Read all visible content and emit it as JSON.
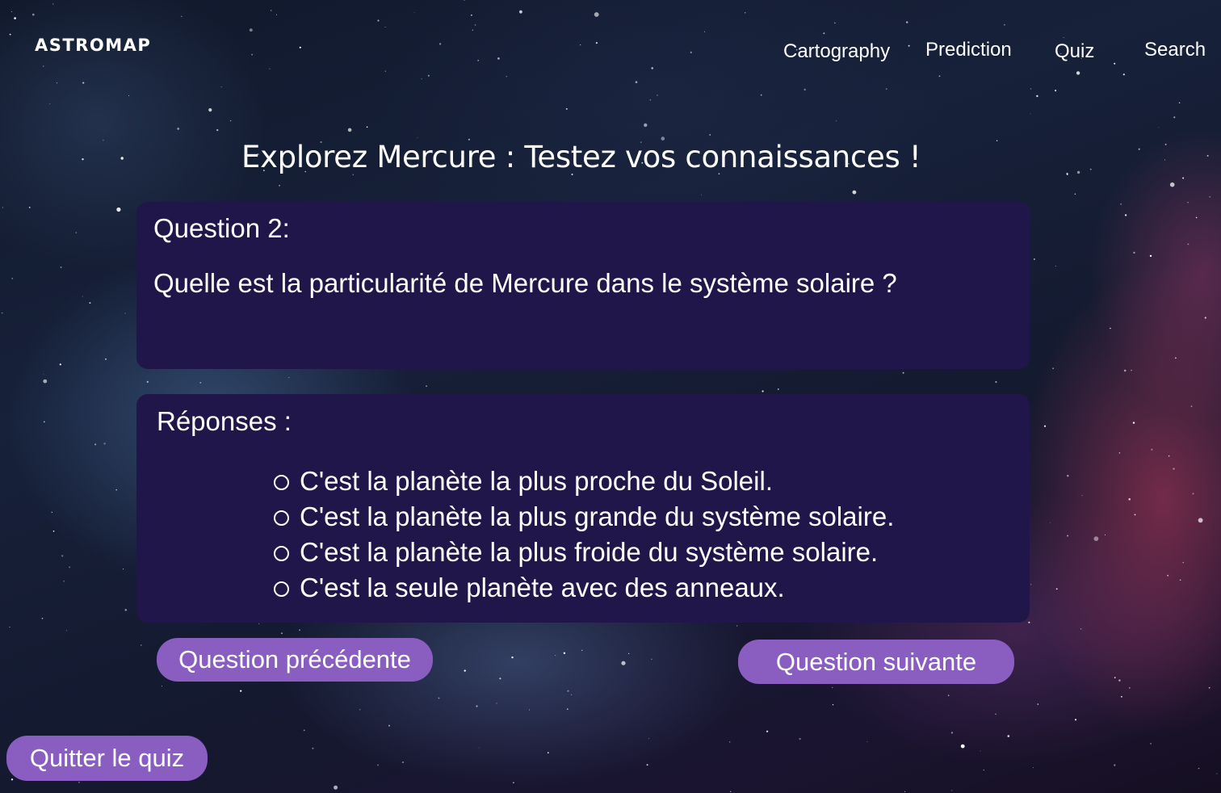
{
  "header": {
    "logo": "ASTROMAP",
    "nav": {
      "cartography": "Cartography",
      "prediction": "Prediction",
      "quiz": "Quiz",
      "search": "Search"
    }
  },
  "quiz": {
    "title": "Explorez Mercure : Testez vos connaissances !",
    "question_label": "Question 2:",
    "question_text": "Quelle est la particularité de Mercure dans le système solaire ?",
    "answers_label": "Réponses :",
    "answers": [
      "C'est la planète la plus proche du Soleil.",
      "C'est la planète la plus grande du système solaire.",
      "C'est la planète la plus froide du système solaire.",
      "C'est la seule planète avec des anneaux."
    ],
    "prev_button": "Question précédente",
    "next_button": "Question suivante",
    "quit_button": "Quitter le quiz"
  },
  "colors": {
    "panel": "#21164a",
    "button": "#8a5ec0",
    "text": "#ffffff"
  }
}
